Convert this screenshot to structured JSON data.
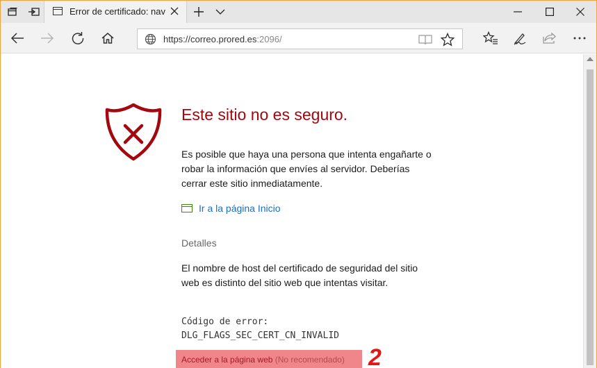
{
  "tab": {
    "title": "Error de certificado: nav"
  },
  "address_bar": {
    "url_host": "https://correo.prored.es",
    "url_port": ":2096/"
  },
  "page": {
    "title": "Este sitio no es seguro.",
    "body": "Es posible que haya una persona que intenta engañarte o robar la información que envíes al servidor. Deberías cerrar este sitio inmediatamente.",
    "home_link": "Ir a la página Inicio",
    "details_heading": "Detalles",
    "details_body": "El nombre de host del certificado de seguridad del sitio web es distinto del sitio web que intentas visitar.",
    "error_code_label": "Código de error:",
    "error_code": "DLG_FLAGS_SEC_CERT_CN_INVALID",
    "proceed_link": "Acceder a la página web",
    "proceed_note": "(No recomendado)",
    "annotation": "2"
  },
  "colors": {
    "title_red": "#a4070e",
    "link_blue": "#1a6fc1",
    "highlight": "#f1868a",
    "annotation_red": "#e01818"
  },
  "icons": [
    "tab-manager-icon",
    "set-aside-tabs-icon",
    "new-tab-icon",
    "chevron-down-icon",
    "minimize-icon",
    "maximize-icon",
    "close-icon",
    "back-icon",
    "forward-icon",
    "refresh-icon",
    "home-icon",
    "globe-icon",
    "reading-view-icon",
    "favorite-star-icon",
    "favorites-hub-icon",
    "notes-pen-icon",
    "share-icon",
    "more-icon",
    "shield-error-icon"
  ]
}
